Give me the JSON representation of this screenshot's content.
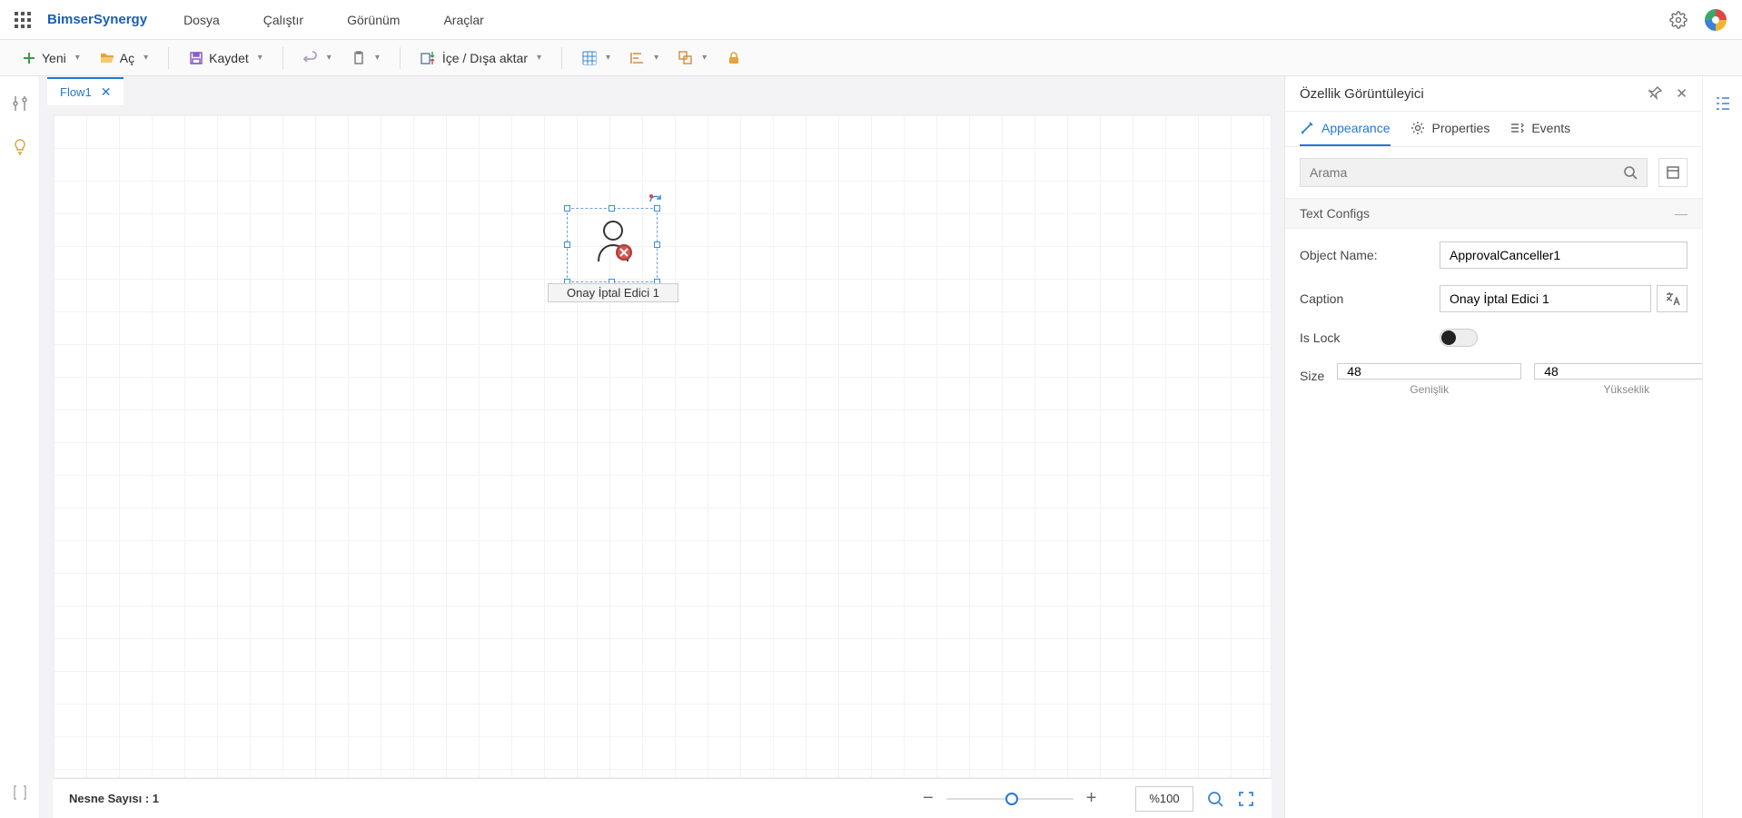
{
  "brand": "BimserSynergy",
  "menu": {
    "file": "Dosya",
    "run": "Çalıştır",
    "view": "Görünüm",
    "tools": "Araçlar"
  },
  "toolbar": {
    "new": "Yeni",
    "open": "Aç",
    "save": "Kaydet",
    "importExport": "İçe / Dışa aktar"
  },
  "tab": {
    "name": "Flow1"
  },
  "node": {
    "label": "Onay İptal Edici 1"
  },
  "statusbar": {
    "count_label": "Nesne Sayısı : 1",
    "zoom": "%100"
  },
  "panel": {
    "title": "Özellik Görüntüleyici",
    "tabs": {
      "appearance": "Appearance",
      "properties": "Properties",
      "events": "Events"
    },
    "search_placeholder": "Arama",
    "group": "Text Configs",
    "fields": {
      "object_name_label": "Object Name:",
      "object_name_value": "ApprovalCanceller1",
      "caption_label": "Caption",
      "caption_value": "Onay İptal Edici 1",
      "islock_label": "Is Lock",
      "size_label": "Size",
      "width_value": "48",
      "height_value": "48",
      "width_hint": "Genişlik",
      "height_hint": "Yükseklik"
    }
  }
}
